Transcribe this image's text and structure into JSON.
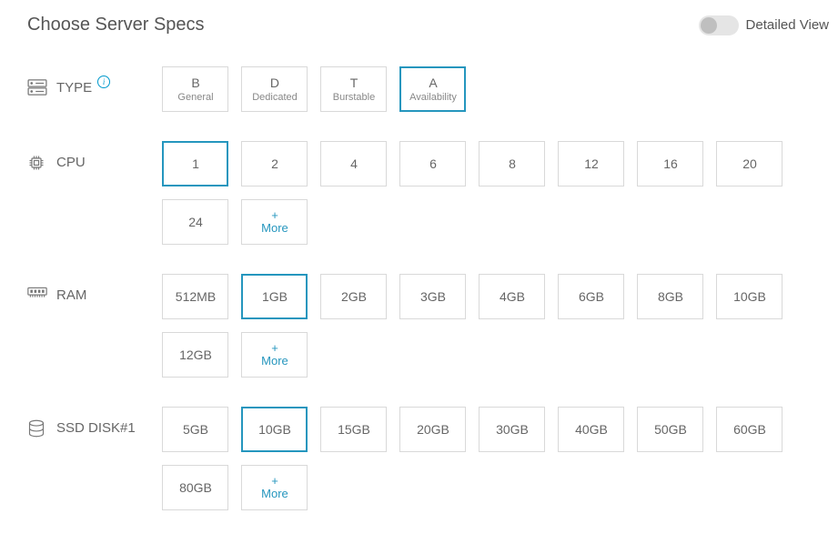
{
  "title": "Choose Server Specs",
  "detailed_view_label": "Detailed View",
  "detailed_view_on": false,
  "more_label": "More",
  "sections": {
    "type": {
      "label": "TYPE",
      "options": [
        {
          "code": "B",
          "name": "General",
          "selected": false
        },
        {
          "code": "D",
          "name": "Dedicated",
          "selected": false
        },
        {
          "code": "T",
          "name": "Burstable",
          "selected": false
        },
        {
          "code": "A",
          "name": "Availability",
          "selected": true
        }
      ]
    },
    "cpu": {
      "label": "CPU",
      "options": [
        {
          "value": "1",
          "selected": true
        },
        {
          "value": "2",
          "selected": false
        },
        {
          "value": "4",
          "selected": false
        },
        {
          "value": "6",
          "selected": false
        },
        {
          "value": "8",
          "selected": false
        },
        {
          "value": "12",
          "selected": false
        },
        {
          "value": "16",
          "selected": false
        },
        {
          "value": "20",
          "selected": false
        },
        {
          "value": "24",
          "selected": false
        }
      ]
    },
    "ram": {
      "label": "RAM",
      "options": [
        {
          "value": "512MB",
          "selected": false
        },
        {
          "value": "1GB",
          "selected": true
        },
        {
          "value": "2GB",
          "selected": false
        },
        {
          "value": "3GB",
          "selected": false
        },
        {
          "value": "4GB",
          "selected": false
        },
        {
          "value": "6GB",
          "selected": false
        },
        {
          "value": "8GB",
          "selected": false
        },
        {
          "value": "10GB",
          "selected": false
        },
        {
          "value": "12GB",
          "selected": false
        }
      ]
    },
    "disk": {
      "label": "SSD DISK#1",
      "options": [
        {
          "value": "5GB",
          "selected": false
        },
        {
          "value": "10GB",
          "selected": true
        },
        {
          "value": "15GB",
          "selected": false
        },
        {
          "value": "20GB",
          "selected": false
        },
        {
          "value": "30GB",
          "selected": false
        },
        {
          "value": "40GB",
          "selected": false
        },
        {
          "value": "50GB",
          "selected": false
        },
        {
          "value": "60GB",
          "selected": false
        },
        {
          "value": "80GB",
          "selected": false
        }
      ]
    }
  }
}
